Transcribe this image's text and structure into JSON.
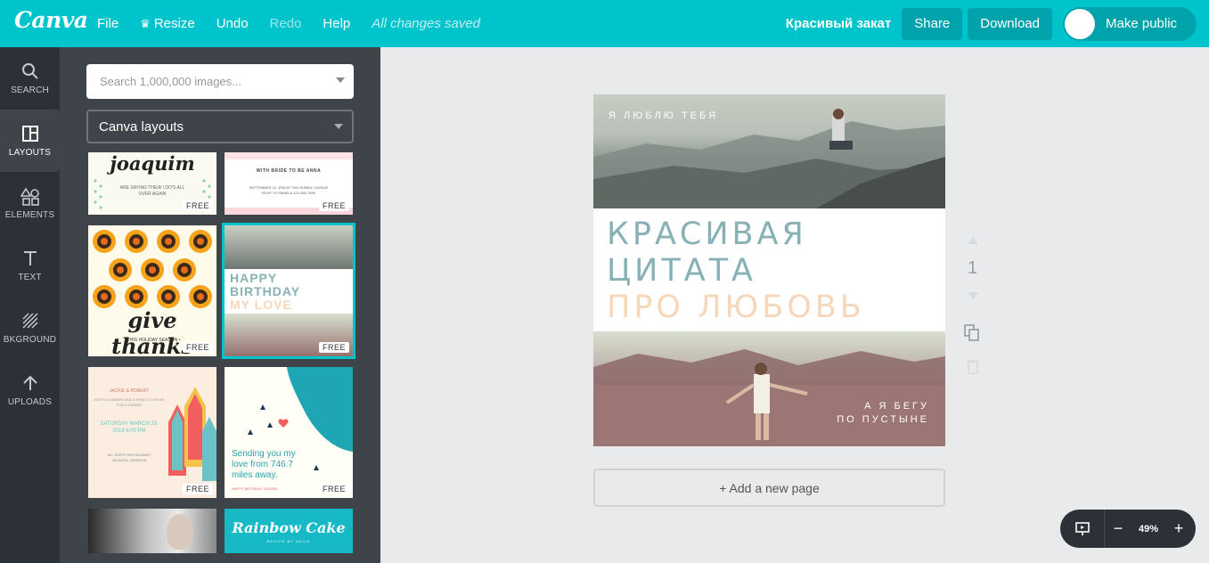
{
  "header": {
    "logo": "Canva",
    "menu": {
      "file": "File",
      "resize": "Resize",
      "undo": "Undo",
      "redo": "Redo",
      "help": "Help",
      "status": "All changes saved"
    },
    "design_title": "Красивый закат",
    "share": "Share",
    "download": "Download",
    "make_public": "Make public"
  },
  "rail": {
    "search": "SEARCH",
    "layouts": "LAYOUTS",
    "elements": "ELEMENTS",
    "text": "TEXT",
    "background": "BKGROUND",
    "uploads": "UPLOADS"
  },
  "panel": {
    "search_placeholder": "Search 1,000,000 images...",
    "select_value": "Canva layouts",
    "free_badge": "FREE",
    "thumbs": {
      "t1_title": "joaquim",
      "t1_sub": "ARE SAYING THEIR I DO'S ALL OVER AGAIN",
      "t2_title": "WITH BRIDE TO BE ANNA",
      "t2_sub": "SEPTEMBER 10, 4PM AT THE RUBEN LOUNGE RSVP TO PAMELA 123-456-7890",
      "t3_title": "give thanks",
      "t3_sub": "• THIS HOLIDAY SEASON •",
      "t4_line1": "HAPPY",
      "t4_line2": "BIRTHDAY",
      "t4_line3": "MY LOVE",
      "t5_head": "JACKIE & ROBERT",
      "t5_sub": "INVITE A DINNER AND A THING TO SHOW FOR A DINNER",
      "t5_date": "SATURDAY MARCH 23, 2019 6:00 PM",
      "t5_place": "ALL PARTS RESTAURANT ATLANTA, GEORGIA",
      "t6_msg": "Sending you my love from 746.7 miles away.",
      "t6_footer": "HAPPY BIRTHDAY, DENISE!",
      "t8_title": "Rainbow Cake",
      "t8_sub": "RECIPE BY HAILA"
    }
  },
  "canvas": {
    "top_small": "Я ЛЮБЛЮ ТЕБЯ",
    "quote_line1": "КРАСИВАЯ",
    "quote_line2": "ЦИТАТА",
    "quote_line3": "ПРО ЛЮБОВЬ",
    "bottom_small_1": "А Я БЕГУ",
    "bottom_small_2": "ПО ПУСТЫНЕ",
    "add_page": "+ Add a new page",
    "page_number": "1"
  },
  "zoom": {
    "minus": "−",
    "value": "49%",
    "plus": "+"
  },
  "colors": {
    "accent": "#00c4cc",
    "quote_teal": "#87b1b5",
    "quote_peach": "#f7d7b9",
    "rail_bg": "#2b3136",
    "panel_bg": "#3e4449"
  }
}
